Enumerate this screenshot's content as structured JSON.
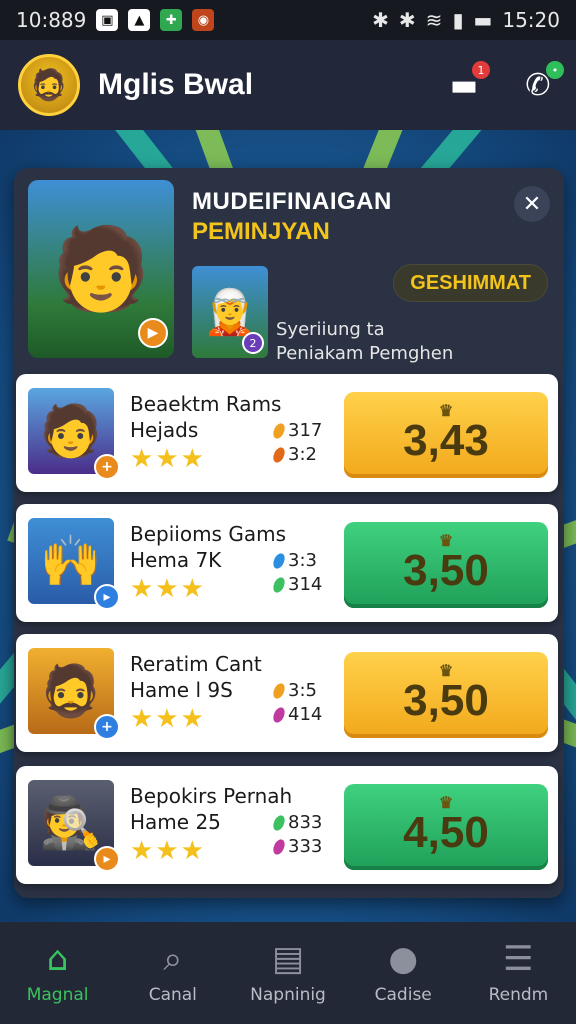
{
  "status_bar": {
    "time_left": "10:889",
    "time_right": "15:20"
  },
  "header": {
    "username": "Mglis Bwal",
    "chat_badge": "1"
  },
  "featured": {
    "title": "MUDEIFINAIGAN",
    "subtitle": "PEMINJYAN",
    "badge": "GESHIMMAT",
    "description_line1": "Syeriiung ta",
    "description_line2": "Peniakam Pemghen",
    "thumb_badge": "2"
  },
  "items": [
    {
      "name": "Beaektm Rams",
      "sub": "Hejads",
      "stat1": "317",
      "stat2": "3:2",
      "price": "3,43"
    },
    {
      "name": "Bepiioms Gams",
      "sub": "Hema 7K",
      "stat1": "3:3",
      "stat2": "314",
      "price": "3,50"
    },
    {
      "name": "Reratim Cant",
      "sub": "Hame l 9S",
      "stat1": "3:5",
      "stat2": "414",
      "price": "3,50"
    },
    {
      "name": "Bepokirs Pernah",
      "sub": "Hame 25",
      "stat1": "833",
      "stat2": "333",
      "price": "4,50"
    }
  ],
  "nav": [
    {
      "label": "Magnal",
      "icon": "home-icon"
    },
    {
      "label": "Canal",
      "icon": "search-icon"
    },
    {
      "label": "Napninig",
      "icon": "clipboard-icon"
    },
    {
      "label": "Cadise",
      "icon": "user-icon"
    },
    {
      "label": "Rendm",
      "icon": "menu-icon"
    }
  ],
  "colors": {
    "accent_green": "#39c45f",
    "gold": "#f3c41c",
    "price_gold": "#ffd14a",
    "price_green": "#3fd17f"
  }
}
